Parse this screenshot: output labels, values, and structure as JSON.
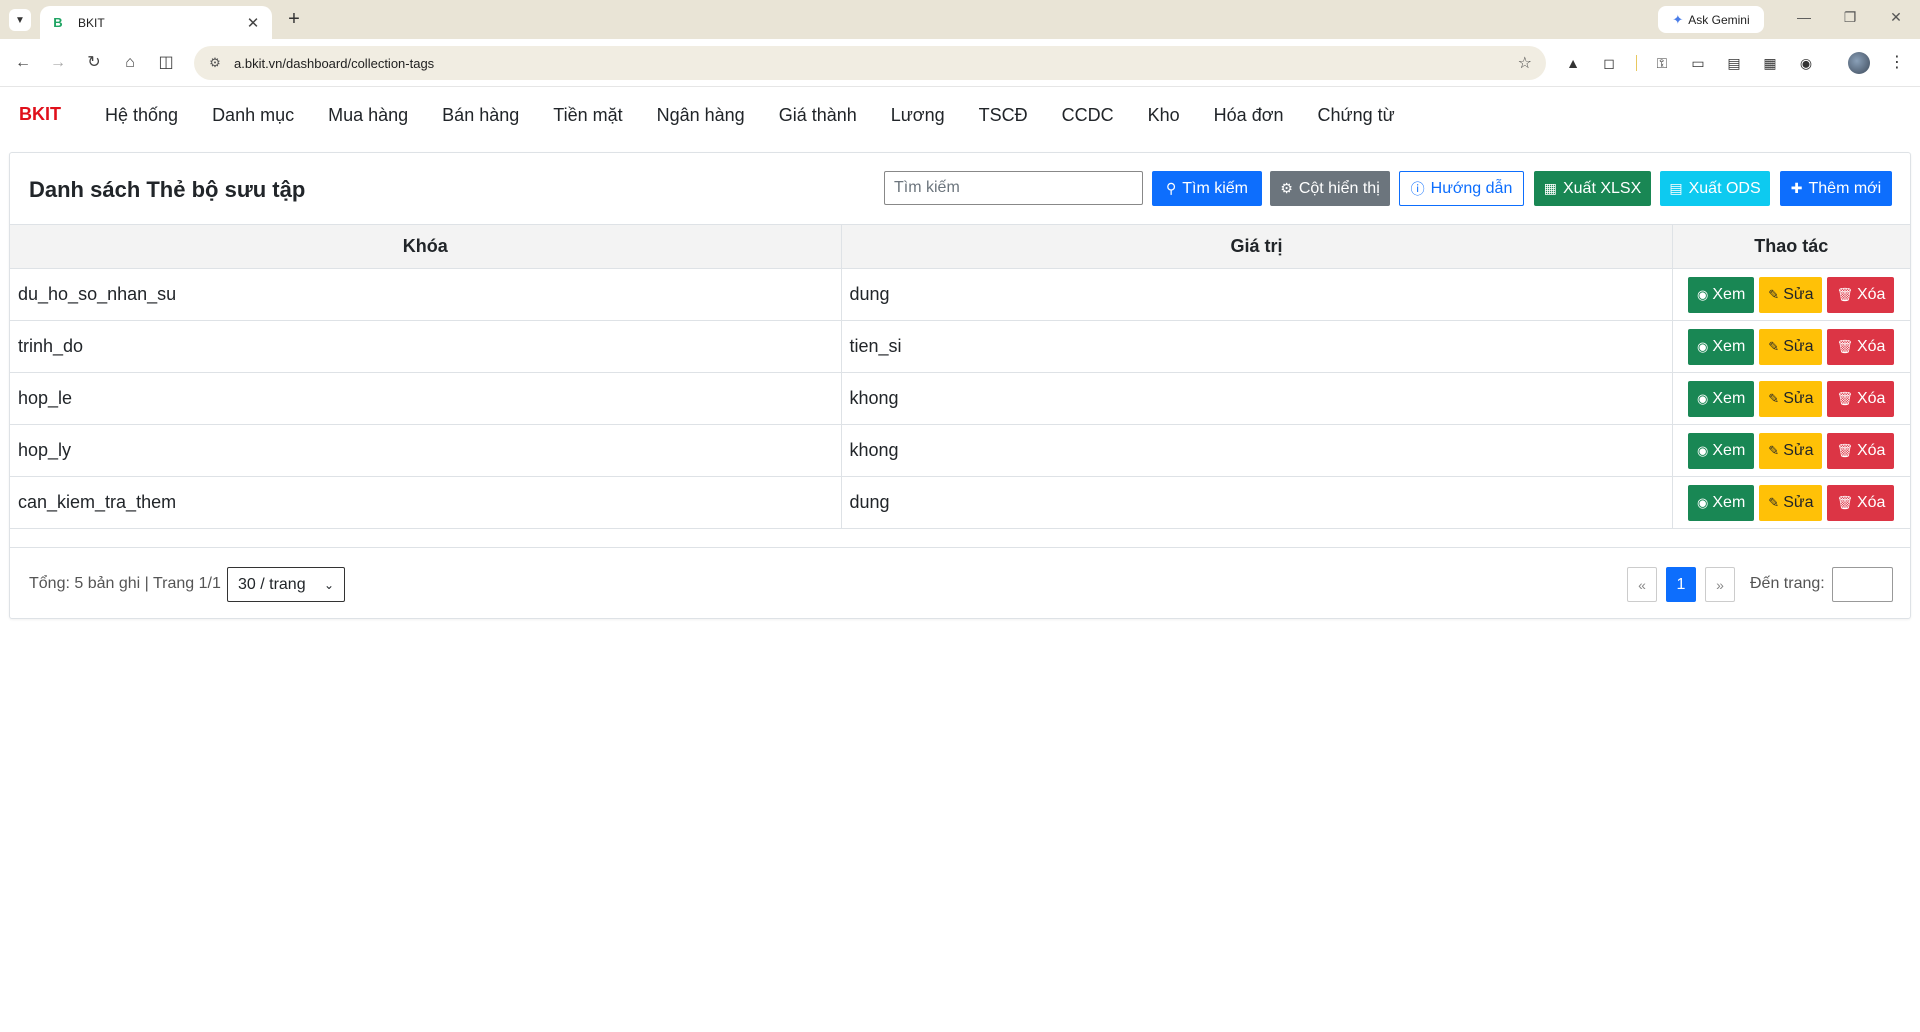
{
  "browser": {
    "tab_title": "BKIT",
    "tab_favicon": "B",
    "new_tab_icon": "+",
    "gemini_label": "Ask Gemini",
    "url": "a.bkit.vn/dashboard/collection-tags"
  },
  "app": {
    "brand": "BKIT",
    "brand_color": "#e0101b",
    "menu": [
      "Hệ thống",
      "Danh mục",
      "Mua hàng",
      "Bán hàng",
      "Tiền mặt",
      "Ngân hàng",
      "Giá thành",
      "Lương",
      "TSCĐ",
      "CCDC",
      "Kho",
      "Hóa đơn",
      "Chứng từ"
    ]
  },
  "page": {
    "title": "Danh sách Thẻ bộ sưu tập",
    "search_placeholder": "Tìm kiếm",
    "buttons": {
      "search": "Tìm kiếm",
      "columns": "Cột hiển thị",
      "guide": "Hướng dẫn",
      "export_xlsx": "Xuất XLSX",
      "export_ods": "Xuất ODS",
      "add_new": "Thêm mới"
    },
    "colors": {
      "primary": "#0d6efd",
      "secondary": "#6c757d",
      "success": "#198754",
      "info": "#0dcaf0",
      "warning": "#ffc107",
      "danger": "#dc3545"
    }
  },
  "table": {
    "headers": [
      "Khóa",
      "Giá trị",
      "Thao tác"
    ],
    "rows": [
      {
        "key": "du_ho_so_nhan_su",
        "value": "dung"
      },
      {
        "key": "trinh_do",
        "value": "tien_si"
      },
      {
        "key": "hop_le",
        "value": "khong"
      },
      {
        "key": "hop_ly",
        "value": "khong"
      },
      {
        "key": "can_kiem_tra_them",
        "value": "dung"
      }
    ],
    "row_actions": {
      "view": "Xem",
      "edit": "Sửa",
      "delete": "Xóa"
    }
  },
  "pagination": {
    "summary": "Tổng: 5 bản ghi | Trang 1/1",
    "page_size": "30 / trang",
    "prev": "«",
    "current": "1",
    "next": "»",
    "goto_label": "Đến trang:"
  }
}
